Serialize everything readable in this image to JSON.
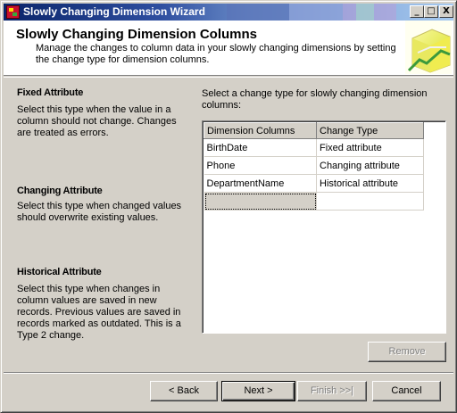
{
  "window": {
    "title": "Slowly Changing Dimension Wizard",
    "caption_buttons": [
      "_",
      "□",
      "X"
    ]
  },
  "header": {
    "title": "Slowly Changing Dimension Columns",
    "description": "Manage the changes to column data in your slowly changing dimensions by setting the change type for dimension columns."
  },
  "info": [
    {
      "heading": "Fixed Attribute",
      "text": "Select this type when the value in a column should not change. Changes are treated as errors."
    },
    {
      "heading": "Changing Attribute",
      "text": "Select this type when changed values should overwrite existing values."
    },
    {
      "heading": "Historical Attribute",
      "text": "Select this type when changes in column values are saved in new records. Previous values are saved in records marked as outdated. This is a Type 2 change."
    }
  ],
  "grid": {
    "caption": "Select a change type for slowly changing dimension columns:",
    "columns": [
      "Dimension Columns",
      "Change Type"
    ],
    "rows": [
      [
        "BirthDate",
        "Fixed attribute"
      ],
      [
        "Phone",
        "Changing attribute"
      ],
      [
        "DepartmentName",
        "Historical attribute"
      ]
    ]
  },
  "buttons": {
    "remove": "Remove",
    "back": "< Back",
    "next": "Next >",
    "finish": "Finish >>|",
    "cancel": "Cancel"
  },
  "colors": {
    "face": "#d4d0c8",
    "title_start": "#0a246a",
    "title_end": "#a6caf0"
  },
  "icons": {
    "window_icon": "wizard-app-icon",
    "header_graphic": "cube-wizard-graphic"
  }
}
